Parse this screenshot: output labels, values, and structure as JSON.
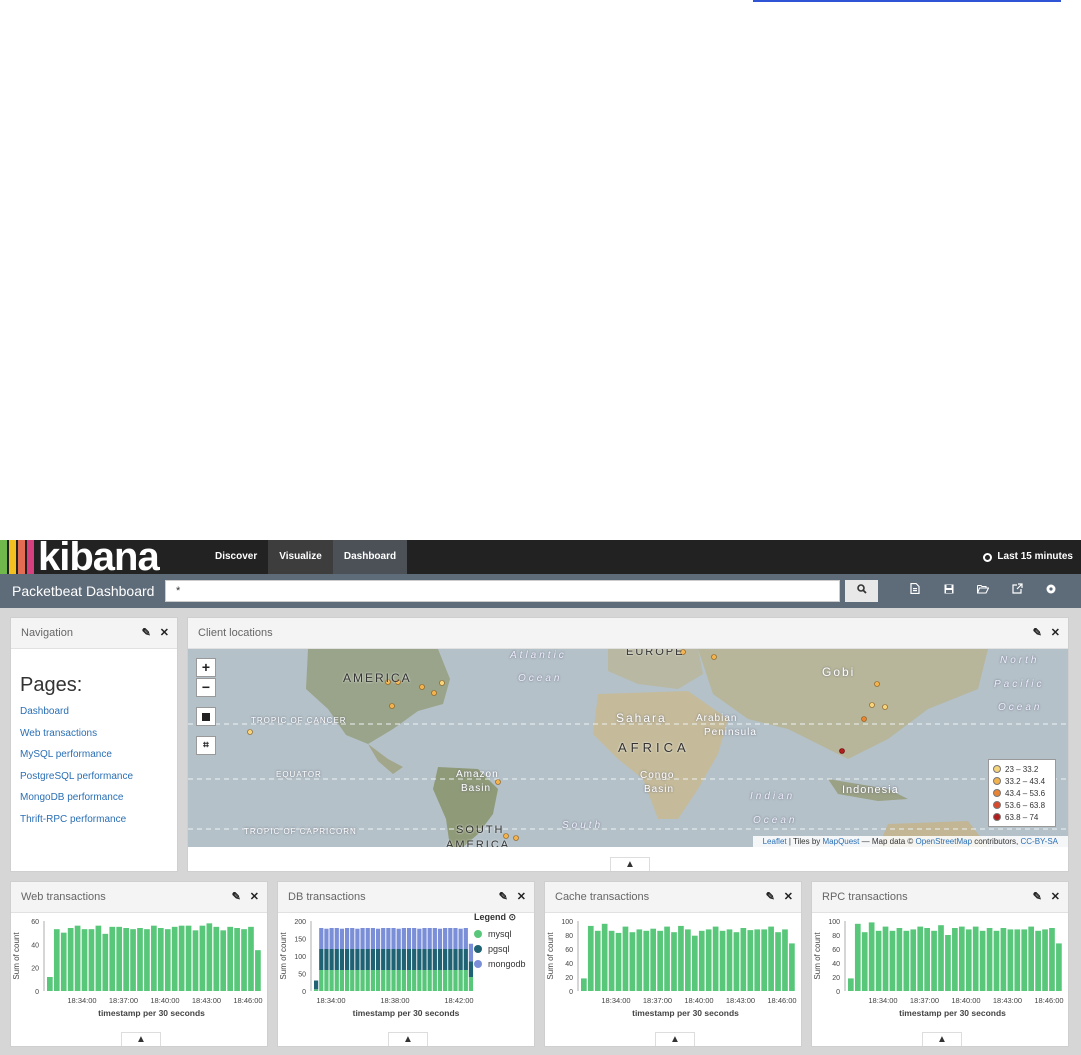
{
  "colors": {
    "bar_green": "#58c77a",
    "mysql": "#58c77a",
    "pgsql": "#1f6273",
    "mongodb": "#7b8fd9",
    "logo_bars": [
      "#70b84b",
      "#f2c01f",
      "#e36d52",
      "#d6407e"
    ]
  },
  "topnav": {
    "logo": "kibana",
    "tabs": [
      "Discover",
      "Visualize",
      "Dashboard"
    ],
    "time_range": "Last 15 minutes"
  },
  "querybar": {
    "dashboard_title": "Packetbeat Dashboard",
    "query_value": "*",
    "search_icon": "search-icon",
    "tool_icons": [
      "new-dashboard-icon",
      "save-icon",
      "open-icon",
      "share-icon",
      "settings-icon"
    ]
  },
  "navigation_panel": {
    "title": "Navigation",
    "pages_title": "Pages:",
    "links": [
      "Dashboard",
      "Web transactions",
      "MySQL performance",
      "PostgreSQL performance",
      "MongoDB performance",
      "Thrift-RPC performance"
    ]
  },
  "map_panel": {
    "title": "Client locations",
    "zoom_in": "+",
    "zoom_out": "−",
    "labels": {
      "atlantic": "Atlantic",
      "ocean1": "Ocean",
      "europe": "EUROPE",
      "gobi": "Gobi",
      "north": "North",
      "pacific": "Pacific",
      "ocean2": "Ocean",
      "america": "AMERICA",
      "tropic_cancer": "TROPIC OF CANCER",
      "sahara": "Sahara",
      "arabian": "Arabian",
      "peninsula": "Peninsula",
      "africa": "AFRICA",
      "equator": "EQUATOR",
      "amazon": "Amazon",
      "basin1": "Basin",
      "congo": "Congo",
      "basin2": "Basin",
      "indian": "Indian",
      "ocean3": "Ocean",
      "indonesia": "Indonesia",
      "tropic_capricorn": "TROPIC OF CAPRICORN",
      "south": "South",
      "south_america": "SOUTH",
      "america2": "AMERICA"
    },
    "legend": [
      "23 – 33.2",
      "33.2 – 43.4",
      "43.4 – 53.6",
      "53.6 – 63.8",
      "63.8 – 74"
    ],
    "legend_colors": [
      "#f6d47b",
      "#f2b24e",
      "#e88434",
      "#d94a2d",
      "#b01e1e"
    ],
    "attribution": {
      "leaflet": "Leaflet",
      "tiles_by": " | Tiles by ",
      "mapquest": "MapQuest",
      "map_data": " — Map data © ",
      "osm": "OpenStreetMap",
      "contributors": " contributors, ",
      "license": "CC-BY-SA"
    }
  },
  "chart_data": [
    {
      "type": "bar",
      "title": "Web transactions",
      "ylabel": "Sum of count",
      "xlabel": "timestamp per 30 seconds",
      "ylim": [
        0,
        60
      ],
      "yticks": [
        0,
        20,
        40,
        60
      ],
      "xticks": [
        "18:34:00",
        "18:37:00",
        "18:40:00",
        "18:43:00",
        "18:46:00"
      ],
      "values": [
        12,
        53,
        50,
        54,
        56,
        53,
        53,
        56,
        49,
        55,
        55,
        54,
        53,
        54,
        53,
        56,
        54,
        53,
        55,
        56,
        56,
        52,
        56,
        58,
        55,
        52,
        55,
        54,
        53,
        55,
        35
      ]
    },
    {
      "type": "bar",
      "stacked": true,
      "title": "DB transactions",
      "ylabel": "Sum of count",
      "xlabel": "timestamp per 30 seconds",
      "ylim": [
        0,
        200
      ],
      "yticks": [
        0,
        50,
        100,
        150,
        200
      ],
      "xticks": [
        "18:34:00",
        "18:38:00",
        "18:42:00"
      ],
      "legend_title": "Legend",
      "series": [
        {
          "name": "mysql",
          "values": [
            5,
            60,
            60,
            60,
            60,
            60,
            60,
            60,
            60,
            60,
            60,
            60,
            60,
            60,
            60,
            60,
            60,
            60,
            60,
            60,
            60,
            60,
            60,
            60,
            60,
            60,
            60,
            60,
            60,
            60,
            40
          ]
        },
        {
          "name": "pgsql",
          "values": [
            25,
            60,
            60,
            60,
            60,
            60,
            60,
            60,
            60,
            60,
            60,
            60,
            60,
            60,
            60,
            60,
            60,
            60,
            60,
            60,
            60,
            60,
            60,
            60,
            60,
            60,
            60,
            60,
            60,
            60,
            45
          ]
        },
        {
          "name": "mongodb",
          "values": [
            0,
            60,
            58,
            60,
            60,
            58,
            60,
            60,
            58,
            60,
            60,
            60,
            58,
            60,
            60,
            60,
            58,
            60,
            60,
            60,
            58,
            60,
            60,
            60,
            58,
            60,
            60,
            60,
            58,
            60,
            50
          ]
        }
      ]
    },
    {
      "type": "bar",
      "title": "Cache transactions",
      "ylabel": "Sum of count",
      "xlabel": "timestamp per 30 seconds",
      "ylim": [
        0,
        100
      ],
      "yticks": [
        0,
        20,
        40,
        60,
        80,
        100
      ],
      "xticks": [
        "18:34:00",
        "18:37:00",
        "18:40:00",
        "18:43:00",
        "18:46:00"
      ],
      "values": [
        18,
        93,
        86,
        96,
        86,
        83,
        92,
        84,
        88,
        86,
        89,
        86,
        92,
        84,
        93,
        88,
        79,
        86,
        88,
        92,
        86,
        88,
        84,
        90,
        87,
        88,
        88,
        92,
        84,
        88,
        68
      ]
    },
    {
      "type": "bar",
      "title": "RPC transactions",
      "ylabel": "Sum of count",
      "xlabel": "timestamp per 30 seconds",
      "ylim": [
        0,
        100
      ],
      "yticks": [
        0,
        20,
        40,
        60,
        80,
        100
      ],
      "xticks": [
        "18:34:00",
        "18:37:00",
        "18:40:00",
        "18:43:00",
        "18:46:00"
      ],
      "values": [
        18,
        96,
        84,
        98,
        86,
        92,
        86,
        90,
        86,
        88,
        92,
        90,
        86,
        94,
        80,
        90,
        92,
        88,
        92,
        86,
        90,
        86,
        90,
        88,
        88,
        88,
        92,
        86,
        88,
        90,
        68
      ]
    }
  ]
}
